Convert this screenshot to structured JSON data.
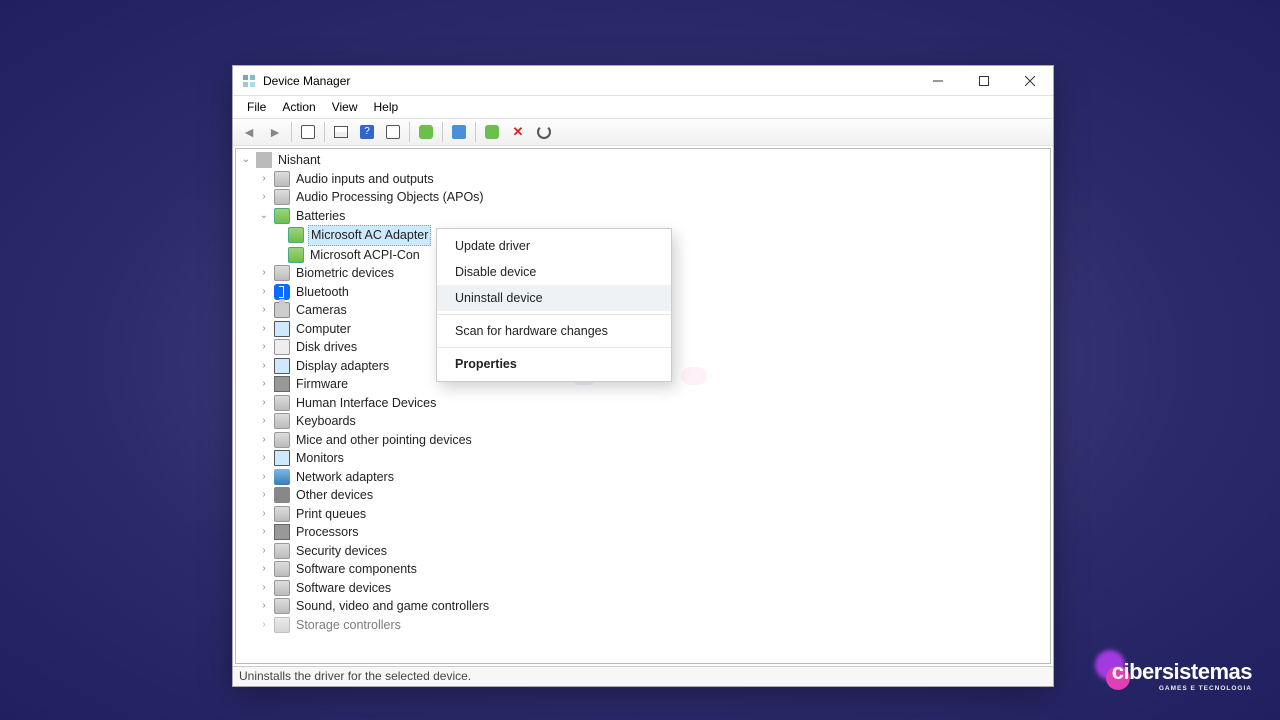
{
  "window": {
    "title": "Device Manager"
  },
  "menu": {
    "file": "File",
    "action": "Action",
    "view": "View",
    "help": "Help"
  },
  "tree": {
    "root": "Nishant",
    "cats": [
      "Audio inputs and outputs",
      "Audio Processing Objects (APOs)",
      "Batteries",
      "Biometric devices",
      "Bluetooth",
      "Cameras",
      "Computer",
      "Disk drives",
      "Display adapters",
      "Firmware",
      "Human Interface Devices",
      "Keyboards",
      "Mice and other pointing devices",
      "Monitors",
      "Network adapters",
      "Other devices",
      "Print queues",
      "Processors",
      "Security devices",
      "Software components",
      "Software devices",
      "Sound, video and game controllers",
      "Storage controllers"
    ],
    "battery_children": [
      "Microsoft AC Adapter",
      "Microsoft ACPI-Con"
    ],
    "selected": "Microsoft AC Adapter"
  },
  "context_menu": {
    "items": [
      "Update driver",
      "Disable device",
      "Uninstall device",
      "Scan for hardware changes",
      "Properties"
    ],
    "highlighted": "Uninstall device",
    "default": "Properties"
  },
  "status": "Uninstalls the driver for the selected device.",
  "brand": {
    "name": "cibersistemas",
    "tag": "GAMES E TECNOLOGIA"
  }
}
